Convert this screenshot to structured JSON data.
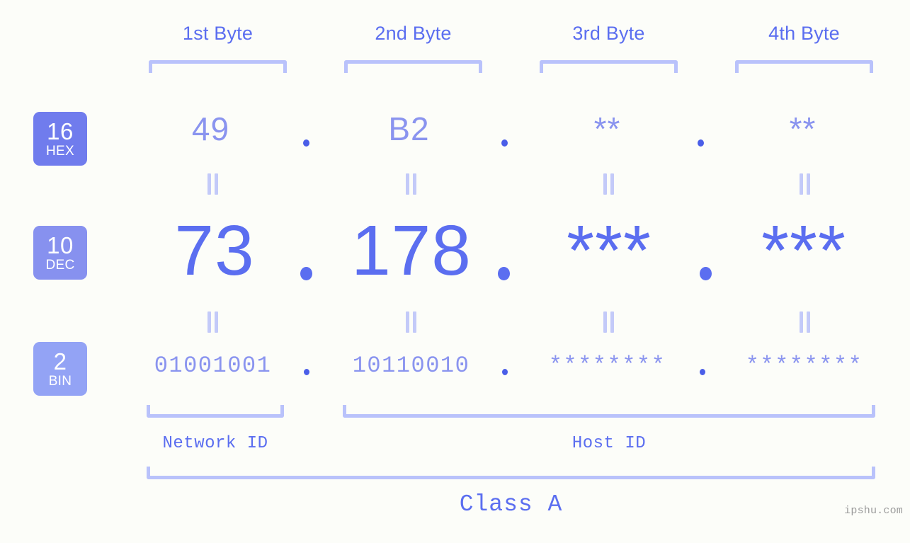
{
  "background_color": "#fcfdf9",
  "accent_colors": {
    "primary": "#5b6ef0",
    "light": "#8a94ef",
    "bracket": "#b9c2fb",
    "connector": "#c3caf9",
    "badge_hex": "#707ced",
    "badge_dec": "#8791ef",
    "badge_bin": "#93a3f5",
    "watermark": "#9b9b9b"
  },
  "byte_headers": [
    {
      "label": "1st Byte"
    },
    {
      "label": "2nd Byte"
    },
    {
      "label": "3rd Byte"
    },
    {
      "label": "4th Byte"
    }
  ],
  "bases": [
    {
      "num": "16",
      "name": "HEX"
    },
    {
      "num": "10",
      "name": "DEC"
    },
    {
      "num": "2",
      "name": "BIN"
    }
  ],
  "rows": {
    "hex": {
      "base_number": "16",
      "base_name": "HEX",
      "values": [
        "49",
        "B2",
        "**",
        "**"
      ],
      "separator": "."
    },
    "dec": {
      "base_number": "10",
      "base_name": "DEC",
      "values": [
        "73",
        "178",
        "***",
        "***"
      ],
      "separator": "."
    },
    "bin": {
      "base_number": "2",
      "base_name": "BIN",
      "values": [
        "01001001",
        "10110010",
        "********",
        "********"
      ],
      "separator": "."
    }
  },
  "connectors": {
    "symbol": "=",
    "description": "equals-connector"
  },
  "id_sections": [
    {
      "label": "Network ID"
    },
    {
      "label": "Host ID"
    }
  ],
  "class_label": "Class A",
  "watermark": "ipshu.com"
}
